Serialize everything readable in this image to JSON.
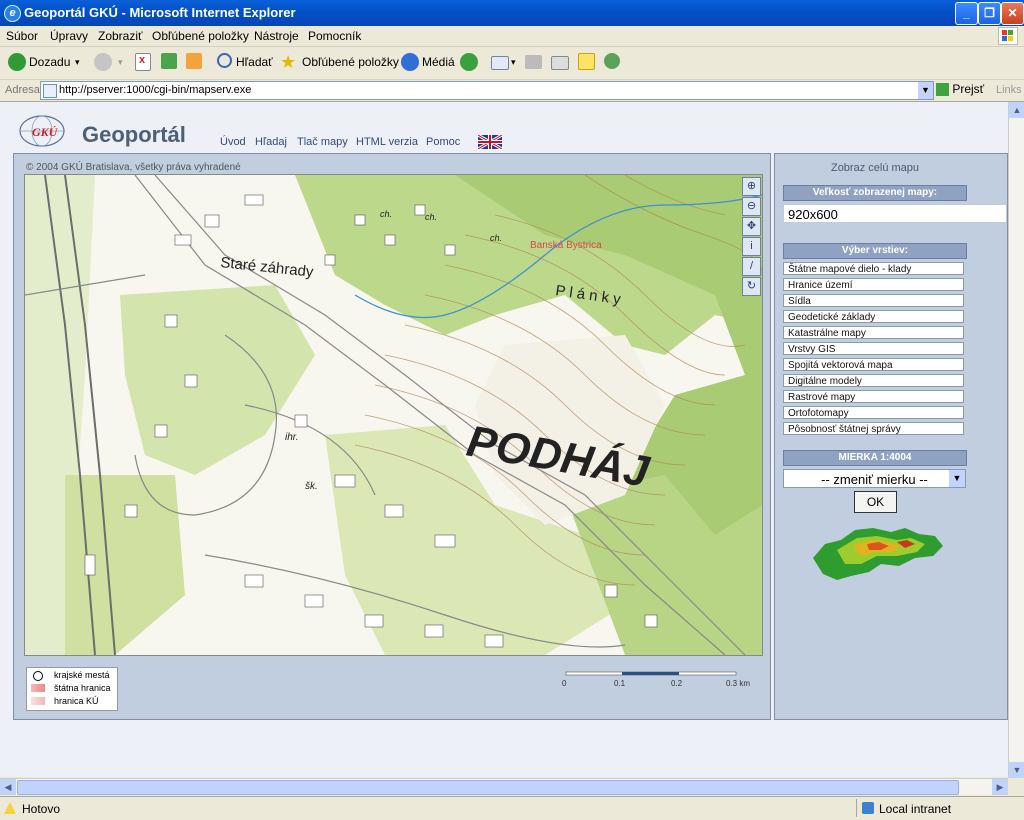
{
  "window": {
    "title": "Geoportál GKÚ - Microsoft Internet Explorer",
    "min": "_",
    "max": "❐",
    "close": "✕"
  },
  "menu": [
    "Súbor",
    "Úpravy",
    "Zobraziť",
    "Obľúbené položky",
    "Nástroje",
    "Pomocník"
  ],
  "toolbar": {
    "back": "Dozadu",
    "search": "Hľadať",
    "favorites": "Obľúbené položky",
    "media": "Médiá"
  },
  "address": {
    "label": "Adresa",
    "url": "http://pserver:1000/cgi-bin/mapserv.exe",
    "go": "Prejsť",
    "links": "Links"
  },
  "site": {
    "brand": "Geoportál",
    "logo_text": "GKÚ",
    "nav": [
      "Úvod",
      "Hľadaj",
      "Tlač mapy",
      "HTML verzia",
      "Pomoc"
    ]
  },
  "map": {
    "copyright": "© 2004 GKÚ Bratislava, všetky práva vyhradené",
    "labels": {
      "podhaj": "PODHÁJ",
      "planky": "P l á n k y",
      "stare_zahrady": "Staré záhrady",
      "banska": "Banská Bystrica",
      "ihr": "ihr.",
      "sk": "šk.",
      "ch1": "ch.",
      "ch2": "ch.",
      "ch3": "ch."
    },
    "tools": [
      "zoom-in",
      "zoom-out",
      "pan",
      "info",
      "measure",
      "refresh"
    ],
    "legend": [
      "krajské mestá",
      "štátna hranica",
      "hranica KÚ"
    ],
    "scale_ticks": [
      "0",
      "0.1",
      "0.2",
      "0.3 km"
    ]
  },
  "side": {
    "show_full": "Zobraz celú mapu",
    "size_label": "Veľkosť zobrazenej mapy:",
    "size_value": "920x600",
    "layers_label": "Výber vrstiev:",
    "layers": [
      "Štátne mapové dielo - klady",
      "Hranice území",
      "Sídla",
      "Geodetické základy",
      "Katastrálne mapy",
      "Vrstvy GIS",
      "Spojitá vektorová mapa",
      "Digitálne modely",
      "Rastrové mapy",
      "Ortofotomapy",
      "Pôsobnosť štátnej správy"
    ],
    "scale_label": "MIERKA 1:4004",
    "scale_select": "-- zmeniť mierku --",
    "ok": "OK"
  },
  "status": {
    "text": "Hotovo",
    "zone": "Local intranet"
  }
}
